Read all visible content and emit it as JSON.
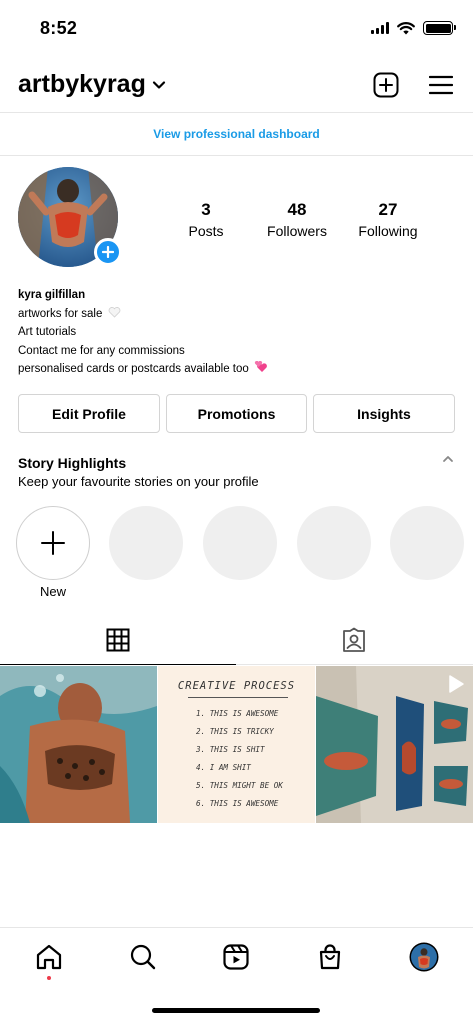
{
  "status_bar": {
    "time": "8:52"
  },
  "header": {
    "username": "artbykyrag"
  },
  "professional_dashboard": {
    "label": "View professional dashboard"
  },
  "stats": [
    {
      "value": "3",
      "label": "Posts"
    },
    {
      "value": "48",
      "label": "Followers"
    },
    {
      "value": "27",
      "label": "Following"
    }
  ],
  "bio": {
    "name": "kyra gilfillan",
    "lines": [
      "artworks for sale",
      "Art tutorials",
      "Contact me for any commissions",
      "personalised cards or postcards available too"
    ]
  },
  "buttons": {
    "edit_profile": "Edit Profile",
    "promotions": "Promotions",
    "insights": "Insights"
  },
  "highlights": {
    "title": "Story Highlights",
    "subtitle": "Keep your favourite stories on your profile",
    "new_label": "New"
  },
  "grid": {
    "post2": {
      "title": "CREATIVE PROCESS",
      "lines": [
        "1. THIS IS AWESOME",
        "2. THIS IS TRICKY",
        "3. THIS IS SHIT",
        "4. I AM SHIT",
        "5. THIS MIGHT BE OK",
        "6. THIS IS AWESOME"
      ]
    }
  },
  "icons": {
    "status": [
      "signal-icon",
      "wifi-icon",
      "battery-icon"
    ],
    "header": [
      "chevron-down-icon",
      "new-post-icon",
      "menu-icon"
    ],
    "tabs": [
      "grid-icon",
      "tagged-icon"
    ],
    "bottom_nav": [
      "home-icon",
      "search-icon",
      "reels-icon",
      "shop-icon",
      "profile-avatar"
    ]
  },
  "colors": {
    "link_blue": "#1a9be6",
    "badge_blue": "#1a95f3",
    "notification_red": "#ed3b4a"
  }
}
